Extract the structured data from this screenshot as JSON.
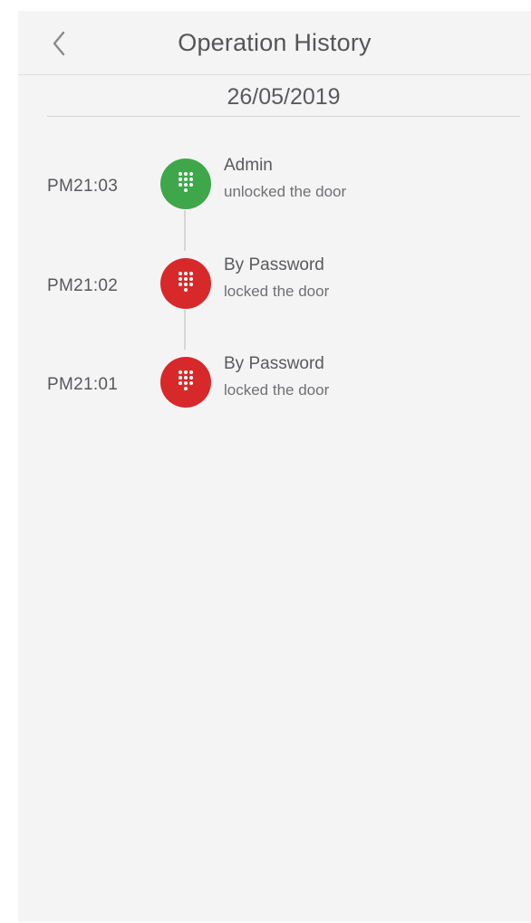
{
  "nav": {
    "title": "Operation History",
    "back_icon": "chevron-left-icon"
  },
  "date_header": "26/05/2019",
  "colors": {
    "unlock": "#3ea74a",
    "lock": "#d7292a"
  },
  "history": [
    {
      "time": "PM21:03",
      "actor": "Admin",
      "action": "unlocked the door",
      "status": "unlock",
      "icon": "keypad-icon"
    },
    {
      "time": "PM21:02",
      "actor": "By Password",
      "action": "locked the door",
      "status": "lock",
      "icon": "keypad-icon"
    },
    {
      "time": "PM21:01",
      "actor": "By Password",
      "action": "locked the door",
      "status": "lock",
      "icon": "keypad-icon"
    }
  ]
}
